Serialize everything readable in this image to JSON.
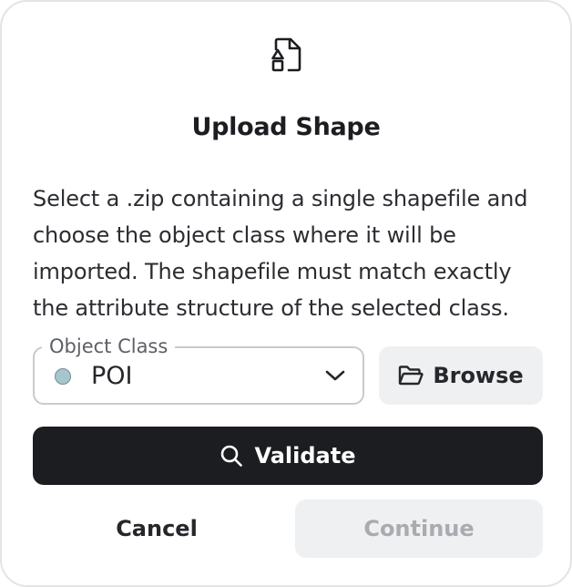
{
  "dialog": {
    "header_icon": "file-shapes-icon",
    "title": "Upload Shape",
    "description": "Select a .zip containing a single shapefile and choose the object class where it will be imported. The shapefile must match exactly the attribute structure of the selected class."
  },
  "object_class": {
    "label": "Object Class",
    "value": "POI",
    "dot_color": "#a7c6cc",
    "icon": "chevron-down-icon"
  },
  "buttons": {
    "browse": {
      "label": "Browse",
      "icon": "folder-open-icon"
    },
    "validate": {
      "label": "Validate",
      "icon": "search-icon"
    },
    "cancel": {
      "label": "Cancel"
    },
    "continue": {
      "label": "Continue",
      "disabled": true
    }
  },
  "colors": {
    "primary": "#1b1d20",
    "secondary_bg": "#eff0f2",
    "disabled_text": "#a9abb0",
    "border": "#c9cacd"
  }
}
